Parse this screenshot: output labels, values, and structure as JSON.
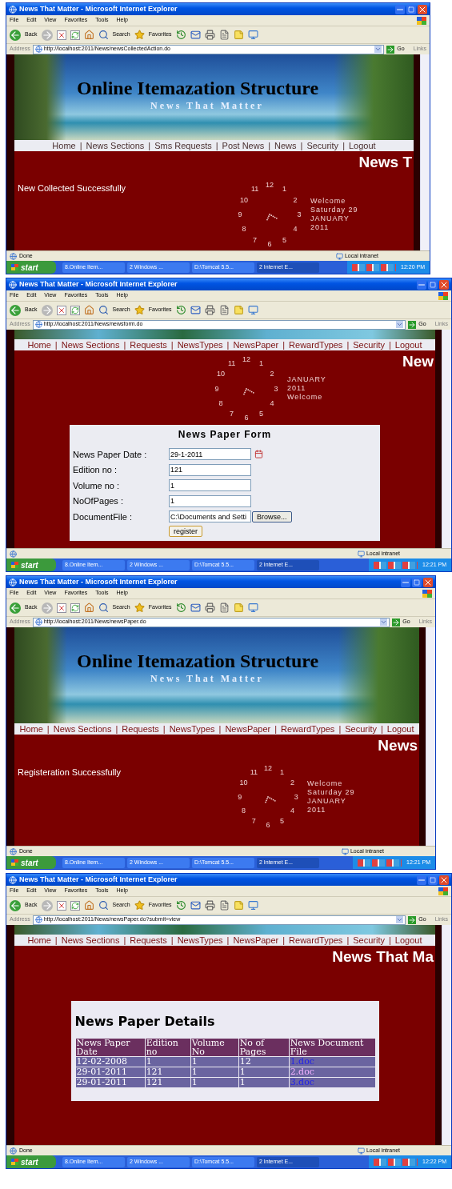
{
  "screenshots": [
    {
      "window": {
        "title": "News That Matter - Microsoft Internet Explorer"
      },
      "menu": [
        "File",
        "Edit",
        "View",
        "Favorites",
        "Tools",
        "Help"
      ],
      "toolbar": {
        "back": "Back",
        "search": "Search",
        "favorites": "Favorites"
      },
      "address": {
        "label": "Address",
        "url": "http://localhost:2011/News/newsCollectedAction.do",
        "go": "Go",
        "links": "Links"
      },
      "page": {
        "banner": {
          "kind": "full",
          "title": "Online Itemazation Structure",
          "subtitle": "News That Matter"
        },
        "nav": {
          "separator": "|",
          "items": [
            "Home",
            "News Sections",
            "Sms Requests",
            "Post News",
            "News",
            "Security",
            "Logout"
          ]
        },
        "heading": "News T",
        "content": {
          "kind": "message",
          "text": "New Collected Successfully"
        },
        "clock": {
          "numerals": [
            "12",
            "1",
            "2",
            "3",
            "4",
            "5",
            "6",
            "7",
            "8",
            "9",
            "10",
            "11"
          ],
          "ring": "Welcome Saturday 29 JANUARY 2011"
        }
      },
      "status": {
        "text": "Done",
        "zone": "Local intranet"
      },
      "taskbar": {
        "start": "start",
        "tasks": [
          {
            "label": "8.Online Item...",
            "selected": false
          },
          {
            "label": "2 Windows ...",
            "selected": false
          },
          {
            "label": "D:\\Tomcat 5.5...",
            "selected": false
          },
          {
            "label": "2 Internet E...",
            "selected": true
          }
        ],
        "time": "12:20 PM"
      }
    },
    {
      "window": {
        "title": "News That Matter - Microsoft Internet Explorer"
      },
      "menu": [
        "File",
        "Edit",
        "View",
        "Favorites",
        "Tools",
        "Help"
      ],
      "toolbar": {
        "back": "Back",
        "search": "Search",
        "favorites": "Favorites"
      },
      "address": {
        "label": "Address",
        "url": "http://localhost:2011/News/newsform.do",
        "go": "Go",
        "links": "Links"
      },
      "page": {
        "banner": {
          "kind": "cropped"
        },
        "nav": {
          "separator": "|",
          "items": [
            "Home",
            "News Sections",
            "Requests",
            "NewsTypes",
            "NewsPaper",
            "RewardTypes",
            "Security",
            "Logout"
          ]
        },
        "heading": "New",
        "content": {
          "kind": "form",
          "title": "News Paper Form",
          "fields": [
            {
              "label": "News Paper Date :",
              "value": "29-1-2011",
              "kind": "date"
            },
            {
              "label": "Edition no :",
              "value": "121",
              "kind": "text"
            },
            {
              "label": "Volume no :",
              "value": "1",
              "kind": "text"
            },
            {
              "label": "NoOfPages :",
              "value": "1",
              "kind": "text"
            },
            {
              "label": "DocumentFile :",
              "value": "C:\\Documents and Setti",
              "kind": "file",
              "button": "Browse..."
            }
          ],
          "submit": "register"
        },
        "clock": {
          "numerals": [
            "12",
            "1",
            "2",
            "3",
            "4",
            "5",
            "6",
            "7",
            "8",
            "9",
            "10",
            "11"
          ],
          "ring": "JANUARY 2011 Welcome"
        }
      },
      "status": {
        "zone": "Local intranet"
      },
      "taskbar": {
        "start": "start",
        "tasks": [
          {
            "label": "8.Online Item...",
            "selected": false
          },
          {
            "label": "2 Windows ...",
            "selected": false
          },
          {
            "label": "D:\\Tomcat 5.5...",
            "selected": false
          },
          {
            "label": "2 Internet E...",
            "selected": true
          }
        ],
        "time": "12:21 PM"
      }
    },
    {
      "window": {
        "title": "News That Matter - Microsoft Internet Explorer"
      },
      "menu": [
        "File",
        "Edit",
        "View",
        "Favorites",
        "Tools",
        "Help"
      ],
      "toolbar": {
        "back": "Back",
        "search": "Search",
        "favorites": "Favorites"
      },
      "address": {
        "label": "Address",
        "url": "http://localhost:2011/News/newsPaper.do",
        "go": "Go",
        "links": "Links"
      },
      "page": {
        "banner": {
          "kind": "full",
          "title": "Online Itemazation Structure",
          "subtitle": "News That Matter"
        },
        "nav": {
          "separator": "|",
          "items": [
            "Home",
            "News Sections",
            "Requests",
            "NewsTypes",
            "NewsPaper",
            "RewardTypes",
            "Security",
            "Logout"
          ]
        },
        "heading": "News",
        "content": {
          "kind": "message",
          "text": "Registeration Successfully"
        },
        "clock": {
          "numerals": [
            "12",
            "1",
            "2",
            "3",
            "4",
            "5",
            "6",
            "7",
            "8",
            "9",
            "10",
            "11"
          ],
          "ring": "Welcome Saturday 29 JANUARY 2011"
        }
      },
      "status": {
        "text": "Done",
        "zone": "Local intranet"
      },
      "taskbar": {
        "start": "start",
        "tasks": [
          {
            "label": "8.Online Item...",
            "selected": false
          },
          {
            "label": "2 Windows ...",
            "selected": false
          },
          {
            "label": "D:\\Tomcat 5.5...",
            "selected": false
          },
          {
            "label": "2 Internet E...",
            "selected": true
          }
        ],
        "time": "12:21 PM"
      }
    },
    {
      "window": {
        "title": "News That Matter - Microsoft Internet Explorer"
      },
      "menu": [
        "File",
        "Edit",
        "View",
        "Favorites",
        "Tools",
        "Help"
      ],
      "toolbar": {
        "back": "Back",
        "search": "Search",
        "favorites": "Favorites"
      },
      "address": {
        "label": "Address",
        "url": "http://localhost:2011/News/newsPaper.do?submit=view",
        "go": "Go",
        "links": "Links"
      },
      "page": {
        "banner": {
          "kind": "cropped"
        },
        "nav": {
          "separator": "|",
          "items": [
            "Home",
            "News Sections",
            "Requests",
            "NewsTypes",
            "NewsPaper",
            "RewardTypes",
            "Security",
            "Logout"
          ]
        },
        "heading": "News That Ma",
        "content": {
          "kind": "table",
          "title": "News Paper Details",
          "columns": [
            "News Paper Date",
            "Edition no",
            "Volume No",
            "No of Pages",
            "News Document File"
          ],
          "rows": [
            {
              "cells": [
                "12-02-2008",
                "1",
                "1",
                "12"
              ],
              "file": {
                "text": "1.doc",
                "visited": false
              }
            },
            {
              "cells": [
                "29-01-2011",
                "121",
                "1",
                "1"
              ],
              "file": {
                "text": "2.doc",
                "visited": true
              }
            },
            {
              "cells": [
                "29-01-2011",
                "121",
                "1",
                "1"
              ],
              "file": {
                "text": "3.doc",
                "visited": false
              }
            }
          ]
        }
      },
      "status": {
        "text": "Done",
        "zone": "Local intranet"
      },
      "taskbar": {
        "start": "start",
        "tasks": [
          {
            "label": "8.Online Item...",
            "selected": false
          },
          {
            "label": "2 Windows ...",
            "selected": false
          },
          {
            "label": "D:\\Tomcat 5.5...",
            "selected": false
          },
          {
            "label": "2 Internet E...",
            "selected": true
          }
        ],
        "time": "12:22 PM"
      }
    }
  ]
}
